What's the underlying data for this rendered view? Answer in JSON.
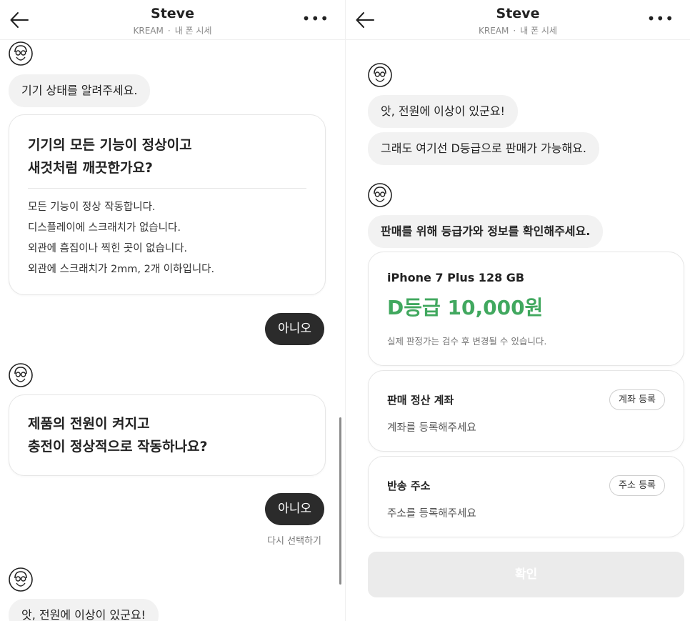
{
  "left": {
    "header": {
      "title": "Steve",
      "brand": "KREAM",
      "separator": "·",
      "category": "내 폰 시세"
    },
    "greeting": "기기 상태를 알려주세요.",
    "question1": {
      "title_lines": [
        "기기의 모든 기능이 정상이고",
        "새것처럼 깨끗한가요?"
      ],
      "conditions": [
        "모든 기능이 정상 작동합니다.",
        "디스플레이에 스크래치가 없습니다.",
        "외관에 흠집이나 찍힌 곳이 없습니다.",
        "외관에 스크래치가 2mm, 2개 이하입니다."
      ]
    },
    "answer1": "아니오",
    "question2": {
      "title_lines": [
        "제품의 전원이 켜지고",
        "충전이 정상적으로 작동하나요?"
      ]
    },
    "answer2": "아니오",
    "reselect": "다시 선택하기",
    "last_message": "앗, 전원에 이상이 있군요!"
  },
  "right": {
    "header": {
      "title": "Steve",
      "brand": "KREAM",
      "separator": "·",
      "category": "내 폰 시세"
    },
    "messages": {
      "power_issue": "앗, 전원에 이상이 있군요!",
      "grade_possible": "그래도 여기선 D등급으로 판매가 가능해요.",
      "confirm_info": "판매를 위해 등급가와 정보를 확인해주세요."
    },
    "product": {
      "name": "iPhone 7 Plus 128 GB",
      "grade_price": "D등급 10,000원",
      "note": "실제 판정가는 검수 후 변경될 수 있습니다."
    },
    "account": {
      "title": "판매 정산 계좌",
      "button": "계좌 등록",
      "placeholder": "계좌를 등록해주세요"
    },
    "address": {
      "title": "반송 주소",
      "button": "주소 등록",
      "placeholder": "주소를 등록해주세요"
    },
    "confirm_button": "확인"
  },
  "icons": {
    "back": "arrow-left-icon",
    "more": "more-horizontal-icon",
    "avatar": "steve-avatar-icon"
  },
  "colors": {
    "grade_price": "#41a85f",
    "answer_bubble": "#2b2b2b",
    "message_bubble": "#f2f2f2",
    "disabled_button": "#ebebeb"
  }
}
